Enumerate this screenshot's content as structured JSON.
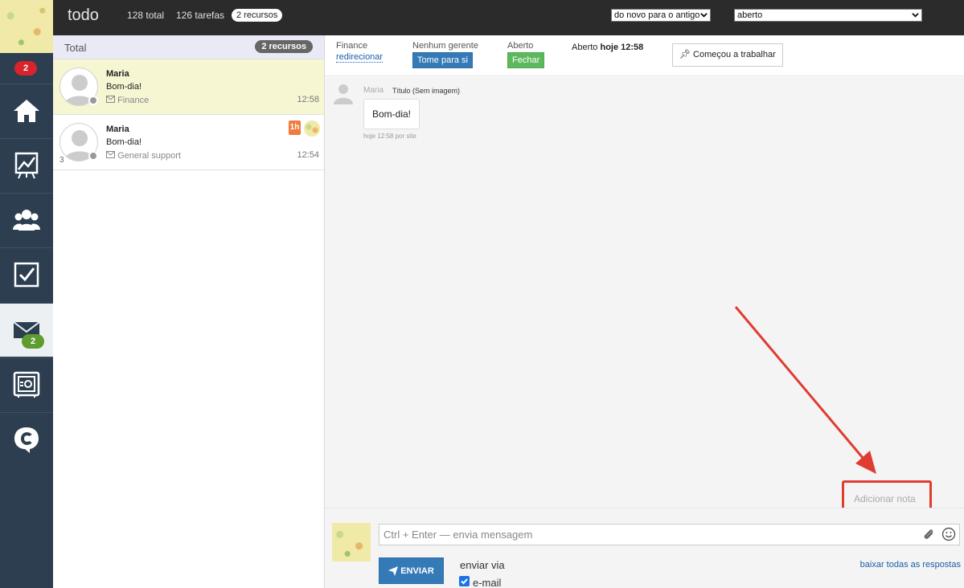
{
  "topbar": {
    "title": "todo",
    "total": "128 total",
    "tasks": "126 tarefas",
    "resources": "2 recursos",
    "sort_select": "do novo para o antigo",
    "status_select": "aberto"
  },
  "sidebar": {
    "top_badge": "2",
    "mail_badge": "2",
    "items": [
      "home-icon",
      "chart-icon",
      "team-icon",
      "checkbox-icon",
      "mail-icon",
      "safe-icon",
      "chat-logo-icon"
    ]
  },
  "list": {
    "header_label": "Total",
    "header_pill": "2 recursos",
    "conversations": [
      {
        "name": "Maria",
        "message": "Bom-dia!",
        "department": "Finance",
        "time": "12:58"
      },
      {
        "name": "Maria",
        "message": "Bom-dia!",
        "department": "General support",
        "time": "12:54",
        "count": "3",
        "tag": "1h"
      }
    ]
  },
  "chat_head": {
    "department_label": "Finance",
    "redirect_link": "redirecionar",
    "manager_label": "Nenhum gerente",
    "take_button": "Tome para si",
    "status_label": "Aberto",
    "close_button": "Fechar",
    "opened_prefix": "Aberto",
    "opened_time": "hoje 12:58",
    "start_button": "Começou a trabalhar"
  },
  "message": {
    "author": "Maria",
    "title": "Título (Sem imagem)",
    "text": "Bom-dia!",
    "meta": "hoje 12:58 por site"
  },
  "note_link": "Adicionar nota",
  "composer": {
    "placeholder": "Ctrl + Enter — envia mensagem",
    "send_button": "ENVIAR",
    "send_via_label": "enviar via",
    "email_label": "e-mail",
    "download_all": "baixar todas as respostas"
  },
  "colors": {
    "annotation_red": "#e03c31",
    "primary_blue": "#337ab7",
    "green": "#5cb85c"
  }
}
